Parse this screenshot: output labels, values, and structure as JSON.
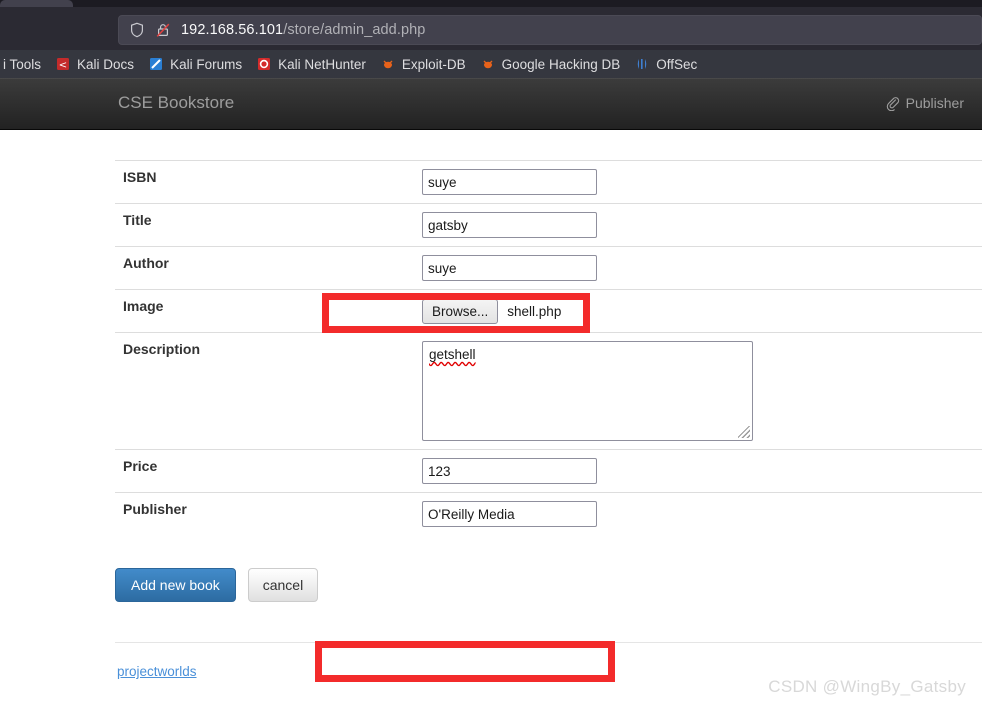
{
  "browser": {
    "url_host": "192.168.56.101",
    "url_path": "/store/admin_add.php",
    "shield_icon": "shield-icon",
    "lock_icon": "lock-insecure-icon",
    "bookmarks": [
      {
        "label": "i Tools",
        "icon": "kali-tools-icon",
        "color": "#5a8fd6"
      },
      {
        "label": "Kali Docs",
        "icon": "kali-docs-icon",
        "color": "#c42b2b"
      },
      {
        "label": "Kali Forums",
        "icon": "kali-forums-icon",
        "color": "#2a7fd4"
      },
      {
        "label": "Kali NetHunter",
        "icon": "kali-nethunter-icon",
        "color": "#d42b2b"
      },
      {
        "label": "Exploit-DB",
        "icon": "exploit-db-icon",
        "color": "#e8621a"
      },
      {
        "label": "Google Hacking DB",
        "icon": "google-hacking-db-icon",
        "color": "#e8621a"
      },
      {
        "label": "OffSec",
        "icon": "offsec-icon",
        "color": "#3f7fd0"
      }
    ]
  },
  "navbar": {
    "brand": "CSE Bookstore",
    "right_link": "Publisher",
    "right_icon": "paperclip-icon"
  },
  "form": {
    "rows": [
      {
        "label": "ISBN",
        "type": "text",
        "value": "suye",
        "highlighted": true
      },
      {
        "label": "Title",
        "type": "text",
        "value": "gatsby",
        "highlighted": false
      },
      {
        "label": "Author",
        "type": "text",
        "value": "suye",
        "highlighted": false
      },
      {
        "label": "Image",
        "type": "file",
        "value": "shell.php",
        "button": "Browse...",
        "highlighted": false
      },
      {
        "label": "Description",
        "type": "textarea",
        "value": "getshell",
        "highlighted": false
      },
      {
        "label": "Price",
        "type": "text",
        "value": "123",
        "highlighted": false
      },
      {
        "label": "Publisher",
        "type": "text",
        "value": "O'Reilly Media",
        "highlighted": true
      }
    ],
    "submit_label": "Add new book",
    "cancel_label": "cancel"
  },
  "footer": {
    "link": "projectworlds",
    "watermark": "CSDN @WingBy_Gatsby"
  },
  "colors": {
    "annotation_red": "#f32b2b",
    "primary_button": "#428bca",
    "link_blue": "#4a90d9",
    "navbar_dark": "#222222"
  }
}
